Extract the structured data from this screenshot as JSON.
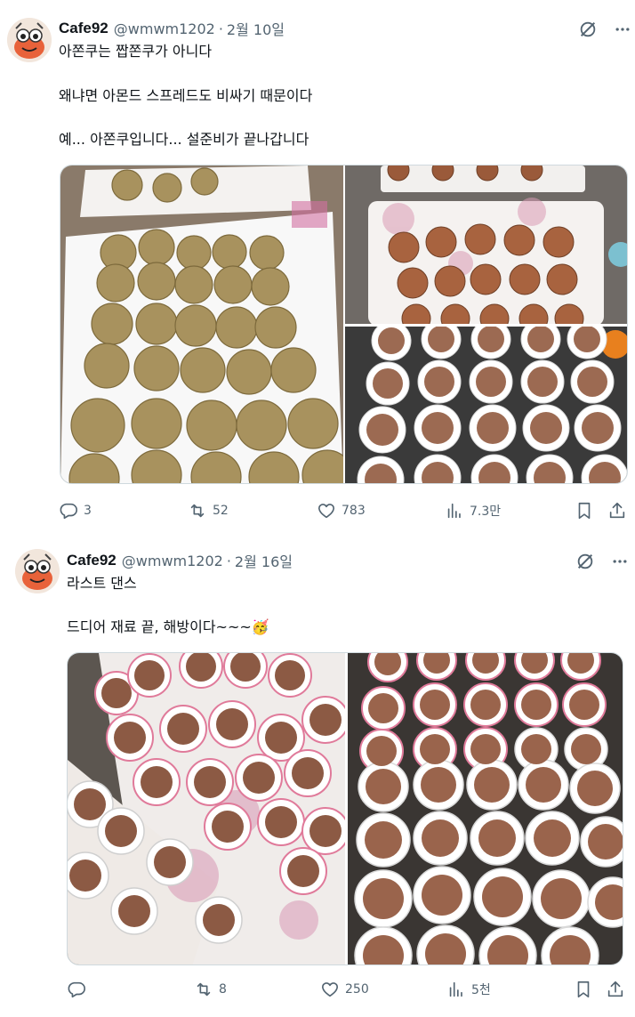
{
  "posts": [
    {
      "author": {
        "name": "Cafe92",
        "handle": "@wmwm1202",
        "date": "2월 10일"
      },
      "lines": [
        "아쫀쿠는 짭쫀쿠가 아니다",
        "왜냐면 아몬드 스프레드도 비싸기 때문이다",
        "예... 아쫀쿠입니다... 설준비가 끝나갑니다"
      ],
      "emoji": "",
      "stats": {
        "replies": "3",
        "reposts": "52",
        "likes": "783",
        "views": "7.3만"
      }
    },
    {
      "author": {
        "name": "Cafe92",
        "handle": "@wmwm1202",
        "date": "2월 16일"
      },
      "lines": [
        "라스트 댄스",
        "드디어 재료 끝, 해방이다~~~"
      ],
      "emoji": "🥳",
      "stats": {
        "replies": "",
        "reposts": "8",
        "likes": "250",
        "views": "5천"
      }
    }
  ],
  "separator": "·",
  "colors": {
    "text": "#0f1419",
    "muted": "#536471",
    "border": "#cfd9de"
  },
  "icons": [
    "avatar",
    "grok-icon",
    "more-icon",
    "reply-icon",
    "repost-icon",
    "like-icon",
    "views-icon",
    "bookmark-icon",
    "share-icon"
  ]
}
